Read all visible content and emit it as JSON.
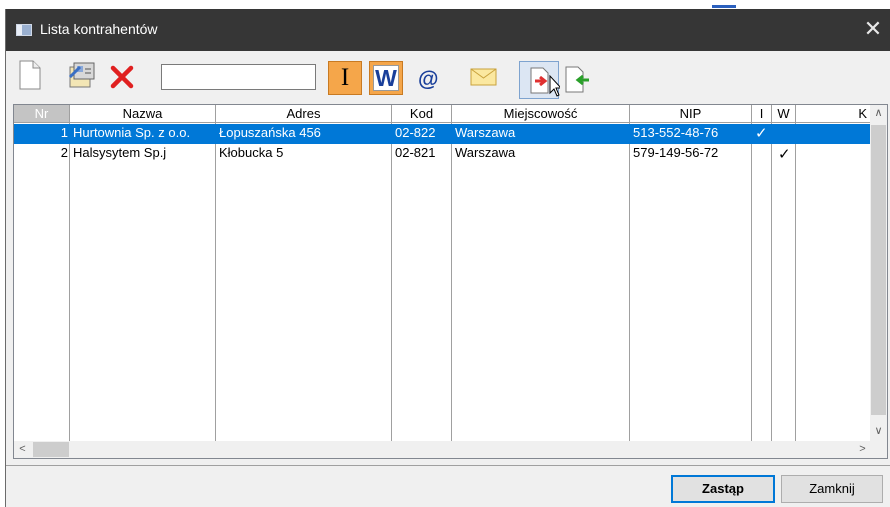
{
  "window": {
    "title": "Lista kontrahentów"
  },
  "toolbar": {
    "search_value": "",
    "i_label": "I",
    "w_label": "W",
    "at_label": "@"
  },
  "grid": {
    "columns": [
      "Nr",
      "Nazwa",
      "Adres",
      "Kod",
      "Miejscowość",
      "NIP",
      "I",
      "W",
      "K"
    ],
    "rows": [
      {
        "nr": "1",
        "nazwa": "Hurtownia Sp. z o.o.",
        "adres": "Łopuszańska 456",
        "kod": "02-822",
        "miejscowosc": "Warszawa",
        "nip": "513-552-48-76",
        "i": "✓",
        "w": ""
      },
      {
        "nr": "2",
        "nazwa": "Halsysytem Sp.j",
        "adres": "Kłobucka 5",
        "kod": "02-821",
        "miejscowosc": "Warszawa",
        "nip": "579-149-56-72",
        "i": "",
        "w": "✓"
      }
    ]
  },
  "buttons": {
    "replace": "Zastąp",
    "close": "Zamknij"
  },
  "colors": {
    "selection": "#0078d7",
    "titlebar": "#363636",
    "accent_orange": "#f5a64a"
  }
}
